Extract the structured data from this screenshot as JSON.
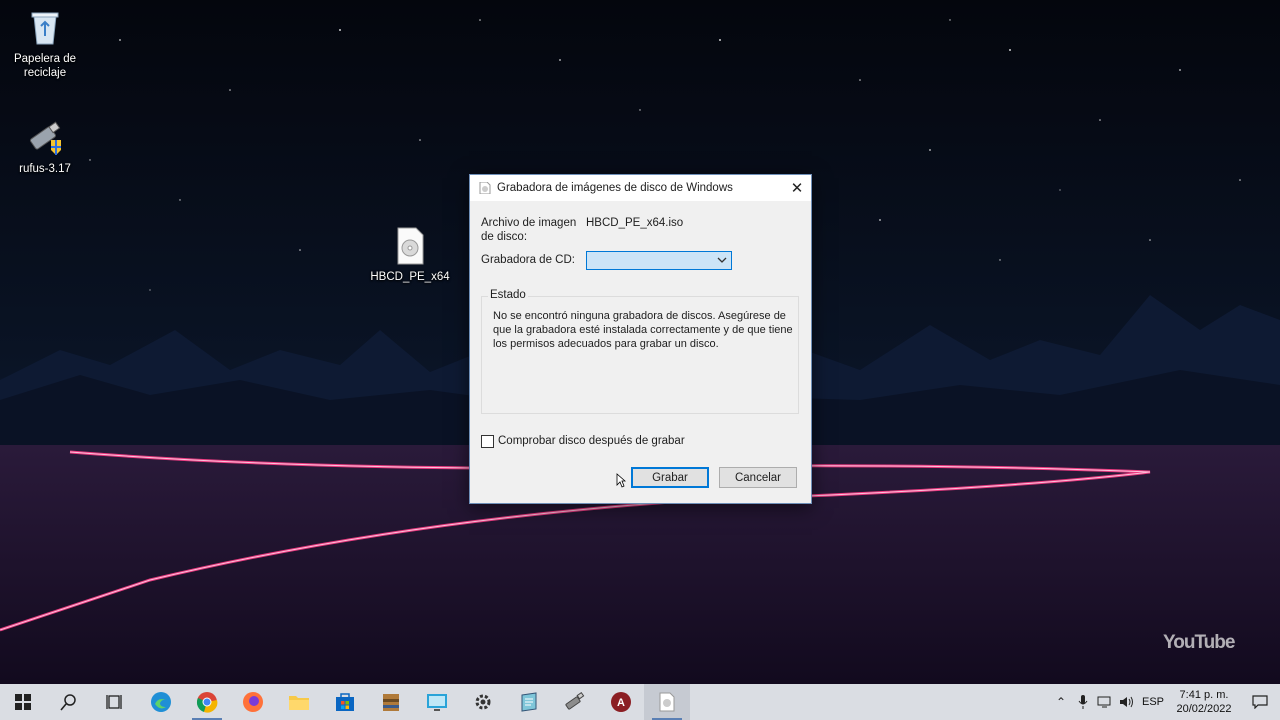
{
  "desktop": {
    "icons": [
      {
        "label_line1": "Papelera de",
        "label_line2": "reciclaje",
        "icon": "recycle-bin-icon"
      },
      {
        "label": "rufus-3.17",
        "icon": "usb-drive-icon"
      },
      {
        "label": "HBCD_PE_x64",
        "icon": "disc-image-file-icon"
      }
    ],
    "watermark": "YouTube"
  },
  "dialog": {
    "title": "Grabadora de imágenes de disco de Windows",
    "image_label_line1": "Archivo de imagen",
    "image_label_line2": "de disco:",
    "image_value": "HBCD_PE_x64.iso",
    "burner_label": "Grabadora de CD:",
    "burner_value": "",
    "status_legend": "Estado",
    "status_message": "No se encontró ninguna grabadora de discos. Asegúrese de que la grabadora esté instalada correctamente y de que tiene los permisos adecuados para grabar un disco.",
    "verify_label": "Comprobar disco después de grabar",
    "verify_checked": false,
    "burn_button": "Grabar",
    "cancel_button": "Cancelar"
  },
  "taskbar": {
    "apps": [
      "start-icon",
      "search-icon",
      "task-view-icon",
      "edge-icon",
      "chrome-icon",
      "firefox-icon",
      "file-explorer-icon",
      "store-icon",
      "archive-icon",
      "remote-desktop-icon",
      "settings-icon",
      "notepad-icon",
      "usb-tool-icon",
      "app-a-icon",
      "disc-burner-icon"
    ],
    "language": "ESP",
    "time": "7:41 p. m.",
    "date": "20/02/2022"
  },
  "colors": {
    "accent": "#0078d7",
    "taskbar": "#dadde3",
    "dialog_bg": "#f0f0f0"
  }
}
